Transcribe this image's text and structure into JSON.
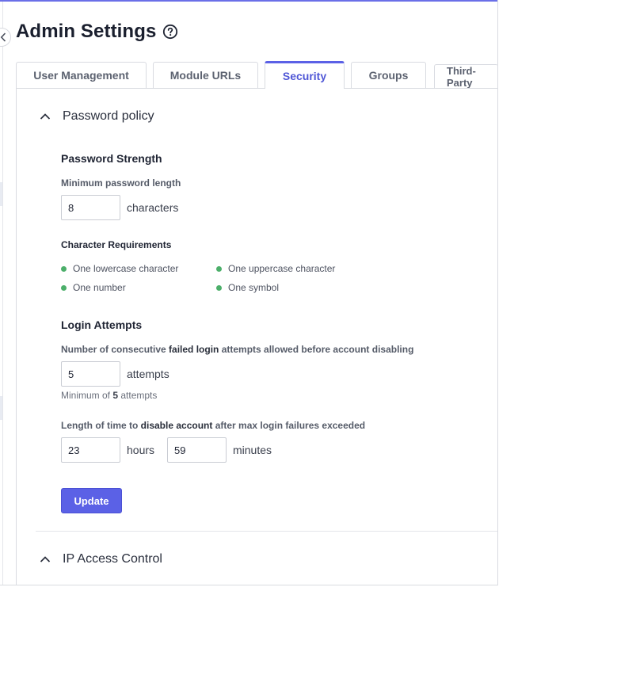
{
  "page": {
    "title": "Admin Settings"
  },
  "icons": {
    "help": "help-circle-icon",
    "collapse": "chevron-left-icon",
    "section_toggle": "chevron-up-icon"
  },
  "colors": {
    "accent": "#5b61e6",
    "status_ok": "#4caf6a",
    "text": "#1f2433"
  },
  "tabs": [
    {
      "label": "User Management",
      "active": false
    },
    {
      "label": "Module URLs",
      "active": false
    },
    {
      "label": "Security",
      "active": true
    },
    {
      "label": "Groups",
      "active": false
    },
    {
      "label": "Third-Party",
      "active": false
    }
  ],
  "password_policy": {
    "title": "Password policy",
    "strength": {
      "heading": "Password Strength",
      "min_length_label": "Minimum password length",
      "min_length_value": "8",
      "min_length_unit": "characters"
    },
    "requirements": {
      "heading": "Character Requirements",
      "items": [
        "One lowercase character",
        "One uppercase character",
        "One number",
        "One symbol"
      ]
    },
    "login_attempts": {
      "heading": "Login Attempts",
      "attempts_label_pre": "Number of consecutive ",
      "attempts_label_bold": "failed login",
      "attempts_label_post": " attempts allowed before account disabling",
      "attempts_value": "5",
      "attempts_unit": "attempts",
      "hint_pre": "Minimum of ",
      "hint_bold": "5",
      "hint_post": " attempts",
      "disable_label_pre": "Length of time to ",
      "disable_label_bold": "disable account",
      "disable_label_post": " after max login failures exceeded",
      "hours_value": "23",
      "hours_unit": "hours",
      "minutes_value": "59",
      "minutes_unit": "minutes"
    },
    "update_label": "Update"
  },
  "ip_access": {
    "title": "IP Access Control"
  }
}
